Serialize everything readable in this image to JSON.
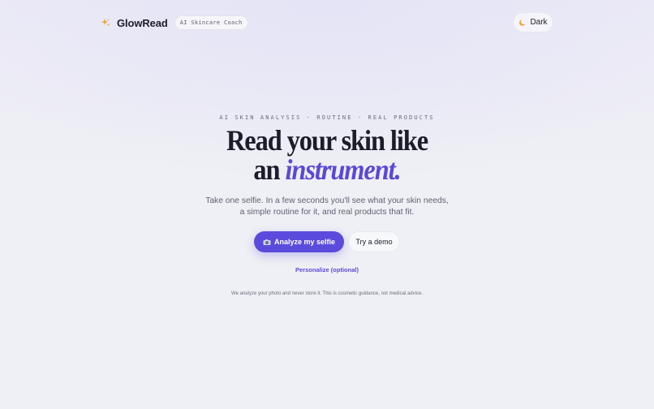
{
  "header": {
    "brand_name": "GlowRead",
    "brand_badge": "AI Skincare Coach",
    "theme_toggle_label": "Dark"
  },
  "hero": {
    "eyebrow": "AI SKIN ANALYSIS · ROUTINE · REAL PRODUCTS",
    "headline_line1": "Read your skin like",
    "headline_line2_prefix": "an ",
    "headline_line2_accent": "instrument.",
    "subtitle_line1": "Take one selfie. In a few seconds you'll see what your skin needs,",
    "subtitle_line2": "a simple routine for it, and real products that fit."
  },
  "actions": {
    "primary_label": "Analyze my selfie",
    "secondary_label": "Try a demo",
    "personalize_label": "Personalize (optional)"
  },
  "footer": {
    "disclaimer": "We analyze your photo and never store it. This is cosmetic guidance, not medical advice."
  },
  "icons": {
    "brand": "sparkles-icon",
    "theme": "moon-icon",
    "primary": "camera-icon"
  },
  "colors": {
    "accent": "#5b4bdc",
    "text": "#1c1c2a",
    "muted": "#5f6072",
    "sparkle": "#e8a33a"
  }
}
